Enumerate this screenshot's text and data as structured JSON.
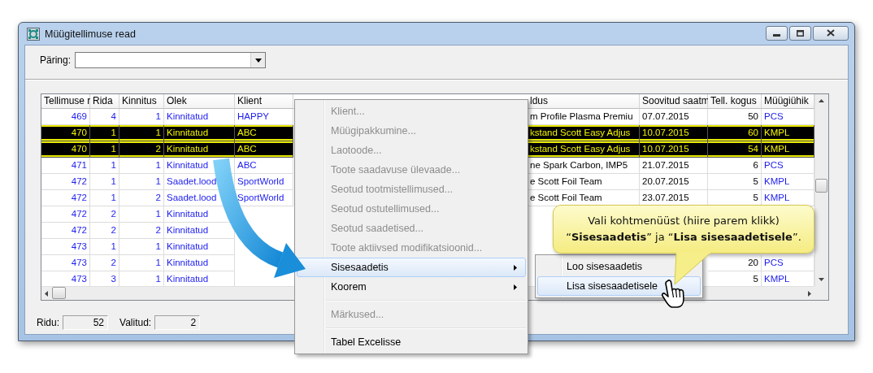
{
  "window": {
    "title": "Müügitellimuse read"
  },
  "query": {
    "label": "Päring:"
  },
  "table": {
    "columns": [
      "Tellimuse r",
      "Rida",
      "Kinnitus",
      "Olek",
      "Klient",
      "ldus",
      "Soovitud saatm",
      "Tell. kogus",
      "Müügiühik"
    ],
    "rows": [
      {
        "selected": false,
        "cells": [
          "469",
          "4",
          "1",
          "Kinnitatud",
          "HAPPY",
          "m Profile Plasma Premiu",
          "07.07.2015",
          "50",
          "PCS"
        ]
      },
      {
        "selected": true,
        "cells": [
          "470",
          "1",
          "1",
          "Kinnitatud",
          "ABC",
          "kstand Scott Easy Adjus",
          "10.07.2015",
          "60",
          "KMPL"
        ]
      },
      {
        "selected": true,
        "cells": [
          "470",
          "1",
          "2",
          "Kinnitatud",
          "ABC",
          "kstand Scott Easy Adjus",
          "10.07.2015",
          "54",
          "KMPL"
        ]
      },
      {
        "selected": false,
        "cells": [
          "471",
          "1",
          "1",
          "Kinnitatud",
          "ABC",
          "ne Spark Carbon, IMP5",
          "21.07.2015",
          "6",
          "PCS"
        ]
      },
      {
        "selected": false,
        "cells": [
          "472",
          "1",
          "1",
          "Saadet.lood",
          "SportWorld",
          "e Scott Foil Team",
          "20.07.2015",
          "5",
          "KMPL"
        ]
      },
      {
        "selected": false,
        "cells": [
          "472",
          "1",
          "2",
          "Saadet.lood",
          "SportWorld",
          "e Scott Foil Team",
          "23.07.2015",
          "5",
          "KMPL"
        ]
      },
      {
        "selected": false,
        "cells": [
          "472",
          "2",
          "1",
          "Kinnitatud",
          null,
          null,
          null,
          null,
          null
        ]
      },
      {
        "selected": false,
        "cells": [
          "472",
          "2",
          "2",
          "Kinnitatud",
          null,
          null,
          null,
          null,
          null
        ]
      },
      {
        "selected": false,
        "cells": [
          "473",
          "1",
          "1",
          "Kinnitatud",
          null,
          null,
          null,
          null,
          null
        ]
      },
      {
        "selected": false,
        "cells": [
          "473",
          "2",
          "1",
          "Kinnitatud",
          null,
          null,
          null,
          "20",
          "PCS"
        ]
      },
      {
        "selected": false,
        "cells": [
          "473",
          "3",
          "1",
          "Kinnitatud",
          null,
          null,
          null,
          "5",
          "KMPL"
        ]
      }
    ]
  },
  "status_bar": [
    {
      "label": "Ridu:",
      "value": "52"
    },
    {
      "label": "Valitud:",
      "value": "2"
    }
  ],
  "context_menu": {
    "items": [
      {
        "kind": "item",
        "label": "Klient...",
        "disabled": true,
        "selected": false,
        "submenu": false
      },
      {
        "kind": "item",
        "label": "Müügipakkumine...",
        "disabled": true,
        "selected": false,
        "submenu": false
      },
      {
        "kind": "item",
        "label": "Laotoode...",
        "disabled": true,
        "selected": false,
        "submenu": false
      },
      {
        "kind": "item",
        "label": "Toote saadavuse ülevaade...",
        "disabled": true,
        "selected": false,
        "submenu": false
      },
      {
        "kind": "item",
        "label": "Seotud tootmistellimused...",
        "disabled": true,
        "selected": false,
        "submenu": false
      },
      {
        "kind": "item",
        "label": "Seotud ostutellimused...",
        "disabled": true,
        "selected": false,
        "submenu": false
      },
      {
        "kind": "item",
        "label": "Seotud saadetised...",
        "disabled": true,
        "selected": false,
        "submenu": false
      },
      {
        "kind": "item",
        "label": "Toote aktiivsed modifikatsioonid...",
        "disabled": true,
        "selected": false,
        "submenu": false
      },
      {
        "kind": "item",
        "label": "Sisesaadetis",
        "disabled": false,
        "selected": true,
        "submenu": true
      },
      {
        "kind": "item",
        "label": "Koorem",
        "disabled": false,
        "selected": false,
        "submenu": true
      },
      {
        "kind": "separator"
      },
      {
        "kind": "item",
        "label": "Märkused...",
        "disabled": true,
        "selected": false,
        "submenu": false
      },
      {
        "kind": "separator"
      },
      {
        "kind": "item",
        "label": "Tabel Excelisse",
        "disabled": false,
        "selected": false,
        "submenu": false
      }
    ]
  },
  "submenu": {
    "items": [
      {
        "label": "Loo sisesaadetis",
        "selected": false
      },
      {
        "label": "Lisa sisesaadetisele",
        "selected": true
      }
    ]
  },
  "callout": {
    "text": "Vali kohtmenüüst (hiire parem klikk)\n“**Sisesaadetis**” ja “**Lisa sisesaadetisele**”."
  }
}
